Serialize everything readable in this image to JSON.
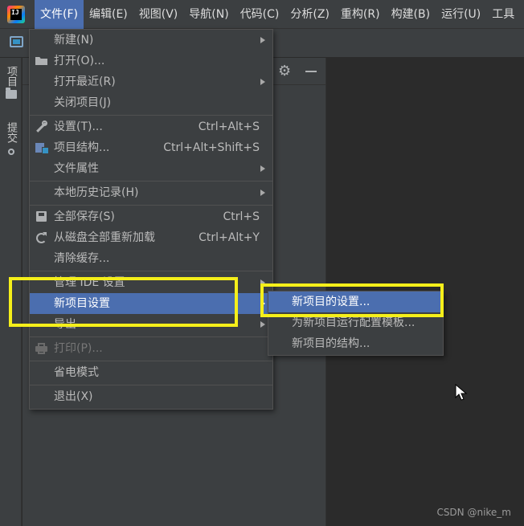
{
  "menubar": {
    "logo_text": "IJ",
    "items": [
      "文件(F)",
      "编辑(E)",
      "视图(V)",
      "导航(N)",
      "代码(C)",
      "分析(Z)",
      "重构(R)",
      "构建(B)",
      "运行(U)",
      "工具"
    ]
  },
  "sidebar": {
    "project_label": "项目",
    "commit_label": "提交"
  },
  "file_menu": {
    "items": [
      {
        "label": "新建(N)",
        "shortcut": "",
        "submenu": true,
        "icon": "",
        "disabled": false
      },
      {
        "label": "打开(O)...",
        "shortcut": "",
        "submenu": false,
        "icon": "folder-open-icon",
        "disabled": false
      },
      {
        "label": "打开最近(R)",
        "shortcut": "",
        "submenu": true,
        "icon": "",
        "disabled": false
      },
      {
        "label": "关闭项目(J)",
        "shortcut": "",
        "submenu": false,
        "icon": "",
        "disabled": false
      },
      {
        "label": "设置(T)...",
        "shortcut": "Ctrl+Alt+S",
        "submenu": false,
        "icon": "wrench-icon",
        "disabled": false
      },
      {
        "label": "项目结构...",
        "shortcut": "Ctrl+Alt+Shift+S",
        "submenu": false,
        "icon": "project-structure-icon",
        "disabled": false
      },
      {
        "label": "文件属性",
        "shortcut": "",
        "submenu": true,
        "icon": "",
        "disabled": false
      },
      {
        "label": "本地历史记录(H)",
        "shortcut": "",
        "submenu": true,
        "icon": "",
        "disabled": false
      },
      {
        "label": "全部保存(S)",
        "shortcut": "Ctrl+S",
        "submenu": false,
        "icon": "save-icon",
        "disabled": false
      },
      {
        "label": "从磁盘全部重新加载",
        "shortcut": "Ctrl+Alt+Y",
        "submenu": false,
        "icon": "reload-icon",
        "disabled": false
      },
      {
        "label": "清除缓存...",
        "shortcut": "",
        "submenu": false,
        "icon": "",
        "disabled": false
      },
      {
        "label": "管理 IDE 设置",
        "shortcut": "",
        "submenu": true,
        "icon": "",
        "disabled": false
      },
      {
        "label": "新项目设置",
        "shortcut": "",
        "submenu": true,
        "icon": "",
        "disabled": false,
        "selected": true
      },
      {
        "label": "导出",
        "shortcut": "",
        "submenu": true,
        "icon": "",
        "disabled": false
      },
      {
        "label": "打印(P)...",
        "shortcut": "",
        "submenu": false,
        "icon": "print-icon",
        "disabled": true
      },
      {
        "label": "省电模式",
        "shortcut": "",
        "submenu": false,
        "icon": "",
        "disabled": false
      },
      {
        "label": "退出(X)",
        "shortcut": "",
        "submenu": false,
        "icon": "",
        "disabled": false
      }
    ]
  },
  "sub_menu": {
    "items": [
      {
        "label": "新项目的设置...",
        "selected": true
      },
      {
        "label": "为新项目运行配置模板..."
      },
      {
        "label": "新项目的结构..."
      }
    ]
  },
  "colors": {
    "accent": "#4b6eaf",
    "highlight": "#f5ef1a",
    "menu_bg": "#3c3f41",
    "editor_bg": "#2b2b2b"
  },
  "watermark": "CSDN @nike_m"
}
